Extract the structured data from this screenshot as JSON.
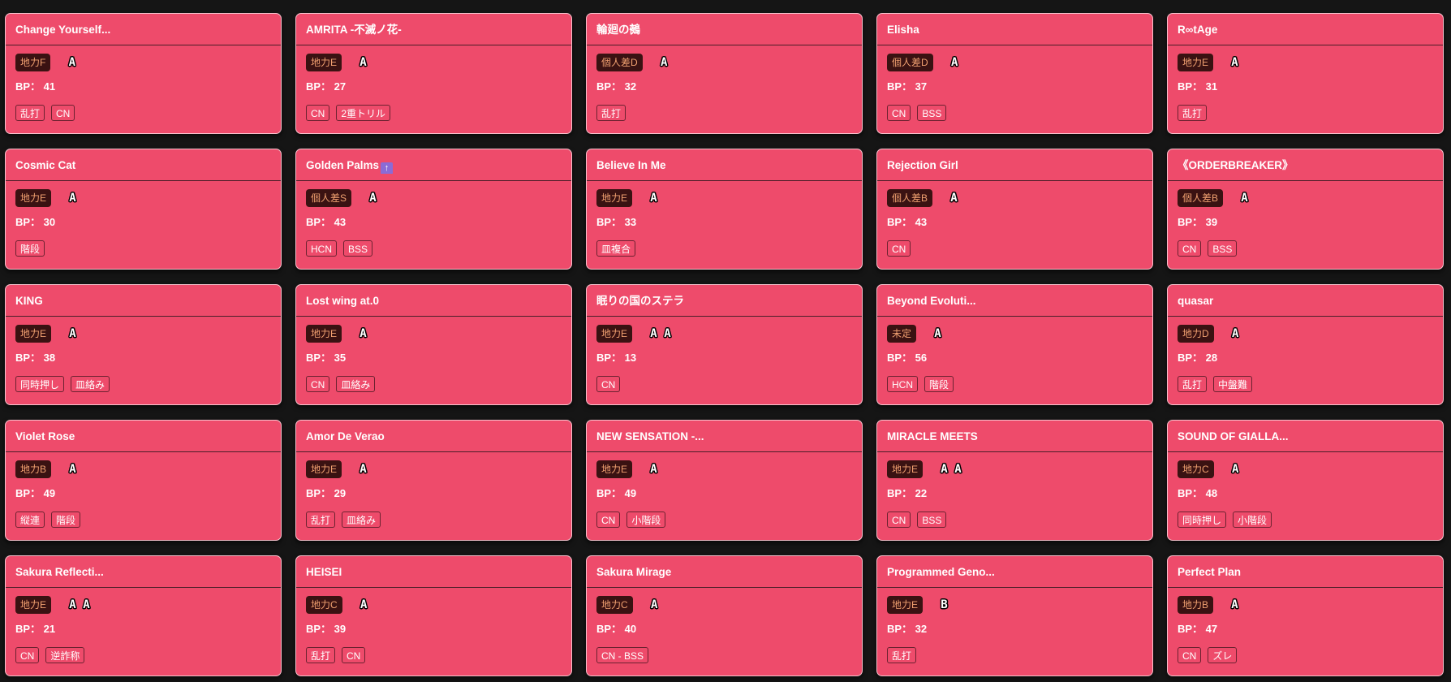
{
  "cards": [
    {
      "title": "Change Yourself...",
      "level": "地力F",
      "grade": "A",
      "bp_label": "BP：",
      "bp": "41",
      "tags": [
        "乱打",
        "CN"
      ]
    },
    {
      "title": "AMRITA -不滅ノ花-",
      "level": "地力E",
      "grade": "A",
      "bp_label": "BP：",
      "bp": "27",
      "tags": [
        "CN",
        "2重トリル"
      ]
    },
    {
      "title": "輪廻の鵺",
      "level": "個人差D",
      "grade": "A",
      "bp_label": "BP：",
      "bp": "32",
      "tags": [
        "乱打"
      ]
    },
    {
      "title": "Elisha",
      "level": "個人差D",
      "grade": "A",
      "bp_label": "BP：",
      "bp": "37",
      "tags": [
        "CN",
        "BSS"
      ]
    },
    {
      "title": "R∞tAge",
      "level": "地力E",
      "grade": "A",
      "bp_label": "BP：",
      "bp": "31",
      "tags": [
        "乱打"
      ]
    },
    {
      "title": "Cosmic Cat",
      "level": "地力E",
      "grade": "A",
      "bp_label": "BP：",
      "bp": "30",
      "tags": [
        "階段"
      ]
    },
    {
      "title": "Golden Palms",
      "up_icon": "↑",
      "level": "個人差S",
      "grade": "A",
      "bp_label": "BP：",
      "bp": "43",
      "tags": [
        "HCN",
        "BSS"
      ]
    },
    {
      "title": "Believe In Me",
      "level": "地力E",
      "grade": "A",
      "bp_label": "BP：",
      "bp": "33",
      "tags": [
        "皿複合"
      ]
    },
    {
      "title": "Rejection Girl",
      "level": "個人差B",
      "grade": "A",
      "bp_label": "BP：",
      "bp": "43",
      "tags": [
        "CN"
      ]
    },
    {
      "title": "《ORDERBREAKER》",
      "level": "個人差B",
      "grade": "A",
      "bp_label": "BP：",
      "bp": "39",
      "tags": [
        "CN",
        "BSS"
      ]
    },
    {
      "title": "KING",
      "level": "地力E",
      "grade": "A",
      "bp_label": "BP：",
      "bp": "38",
      "tags": [
        "同時押し",
        "皿絡み"
      ]
    },
    {
      "title": "Lost wing at.0",
      "level": "地力E",
      "grade": "A",
      "bp_label": "BP：",
      "bp": "35",
      "tags": [
        "CN",
        "皿絡み"
      ]
    },
    {
      "title": "眠りの国のステラ",
      "level": "地力E",
      "grade": "AA",
      "bp_label": "BP：",
      "bp": "13",
      "tags": [
        "CN"
      ]
    },
    {
      "title": "Beyond Evoluti...",
      "level": "未定",
      "grade": "A",
      "bp_label": "BP：",
      "bp": "56",
      "tags": [
        "HCN",
        "階段"
      ]
    },
    {
      "title": "quasar",
      "level": "地力D",
      "grade": "A",
      "bp_label": "BP：",
      "bp": "28",
      "tags": [
        "乱打",
        "中盤難"
      ]
    },
    {
      "title": "Violet Rose",
      "level": "地力B",
      "grade": "A",
      "bp_label": "BP：",
      "bp": "49",
      "tags": [
        "縦連",
        "階段"
      ]
    },
    {
      "title": "Amor De Verao",
      "level": "地力E",
      "grade": "A",
      "bp_label": "BP：",
      "bp": "29",
      "tags": [
        "乱打",
        "皿絡み"
      ]
    },
    {
      "title": "NEW SENSATION -...",
      "level": "地力E",
      "grade": "A",
      "bp_label": "BP：",
      "bp": "49",
      "tags": [
        "CN",
        "小階段"
      ]
    },
    {
      "title": "MIRACLE MEETS",
      "level": "地力E",
      "grade": "AA",
      "bp_label": "BP：",
      "bp": "22",
      "tags": [
        "CN",
        "BSS"
      ]
    },
    {
      "title": "SOUND OF GIALLA...",
      "level": "地力C",
      "grade": "A",
      "bp_label": "BP：",
      "bp": "48",
      "tags": [
        "同時押し",
        "小階段"
      ]
    },
    {
      "title": "Sakura Reflecti...",
      "level": "地力E",
      "grade": "AA",
      "bp_label": "BP：",
      "bp": "21",
      "tags": [
        "CN",
        "逆詐称"
      ]
    },
    {
      "title": "HEISEI",
      "level": "地力C",
      "grade": "A",
      "bp_label": "BP：",
      "bp": "39",
      "tags": [
        "乱打",
        "CN"
      ]
    },
    {
      "title": "Sakura Mirage",
      "level": "地力C",
      "grade": "A",
      "bp_label": "BP：",
      "bp": "40",
      "tags": [
        "CN - BSS"
      ]
    },
    {
      "title": "Programmed Geno...",
      "level": "地力E",
      "grade": "B",
      "bp_label": "BP：",
      "bp": "32",
      "tags": [
        "乱打"
      ]
    },
    {
      "title": "Perfect Plan",
      "level": "地力B",
      "grade": "A",
      "bp_label": "BP：",
      "bp": "47",
      "tags": [
        "CN",
        "ズレ"
      ]
    }
  ],
  "colors": {
    "background": "#151515",
    "card": "#ee4b6b",
    "level_badge_bg": "#3a1212",
    "level_badge_text": "#f0a070",
    "up_icon": "#8a6bd6"
  }
}
